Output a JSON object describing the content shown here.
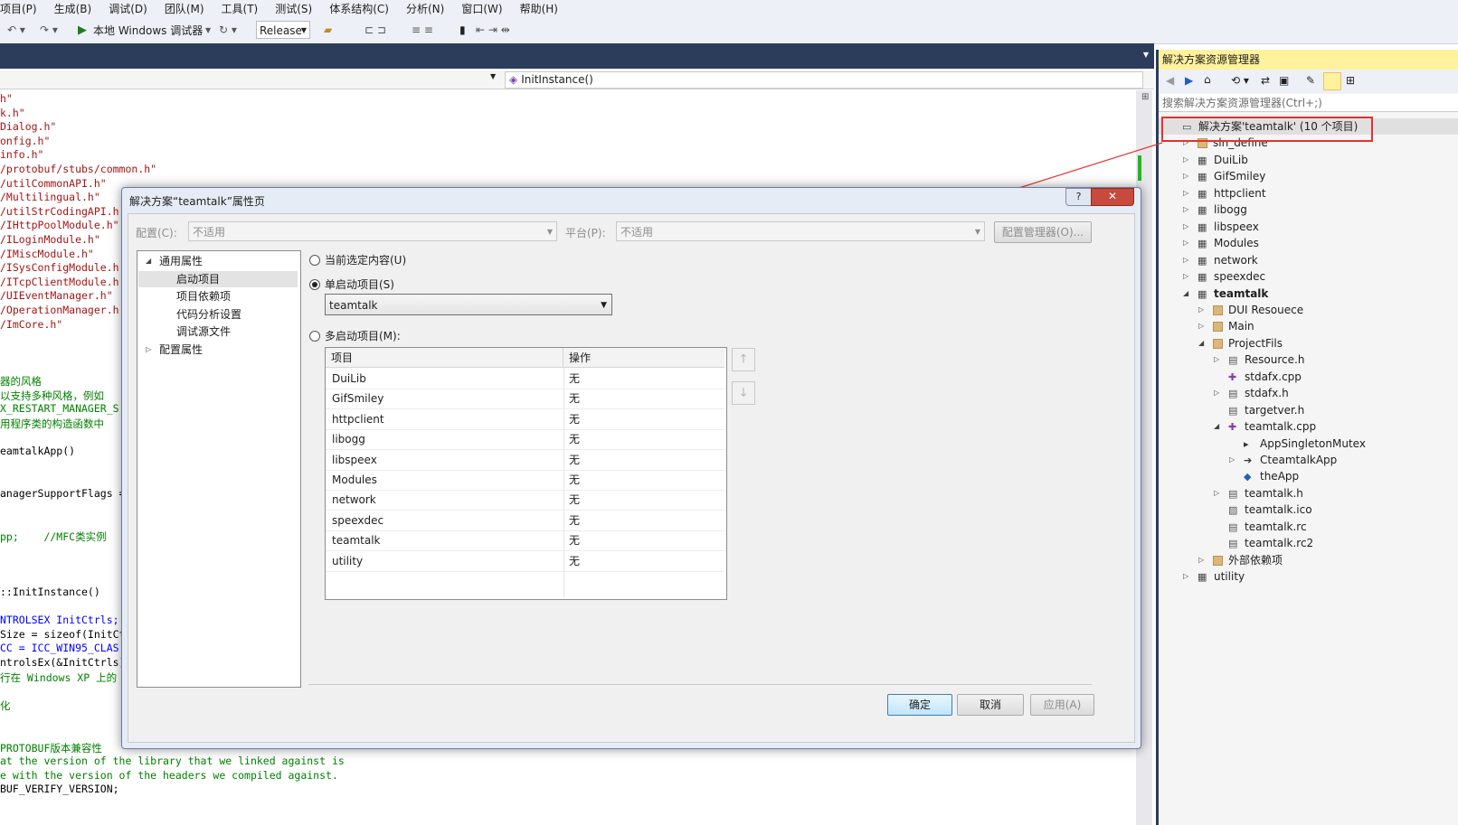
{
  "menu": [
    "项目(P)",
    "生成(B)",
    "调试(D)",
    "团队(M)",
    "工具(T)",
    "测试(S)",
    "体系结构(C)",
    "分析(N)",
    "窗口(W)",
    "帮助(H)"
  ],
  "toolbar": {
    "debugger_label": "本地 Windows 调试器",
    "config": "Release"
  },
  "editor": {
    "nav_right": "InitInstance()",
    "lines": [
      {
        "t": "h\"",
        "c": "red"
      },
      {
        "t": "k.h\"",
        "c": "red"
      },
      {
        "t": "Dialog.h\"",
        "c": "red"
      },
      {
        "t": "onfig.h\"",
        "c": "red"
      },
      {
        "t": "info.h\"",
        "c": "red"
      },
      {
        "t": "/protobuf/stubs/common.h\"",
        "c": "red"
      },
      {
        "t": "/utilCommonAPI.h\"",
        "c": "red"
      },
      {
        "t": "/Multilingual.h\"",
        "c": "red"
      },
      {
        "t": "/utilStrCodingAPI.h",
        "c": "red"
      },
      {
        "t": "/IHttpPoolModule.h\"",
        "c": "red"
      },
      {
        "t": "/ILoginModule.h\"",
        "c": "red"
      },
      {
        "t": "/IMiscModule.h\"",
        "c": "red"
      },
      {
        "t": "/ISysConfigModule.h",
        "c": "red"
      },
      {
        "t": "/ITcpClientModule.h",
        "c": "red"
      },
      {
        "t": "/UIEventManager.h\"",
        "c": "red"
      },
      {
        "t": "/OperationManager.h",
        "c": "red"
      },
      {
        "t": "/ImCore.h\"",
        "c": "red"
      },
      {
        "t": "",
        "c": "blk"
      },
      {
        "t": "",
        "c": "blk"
      },
      {
        "t": "",
        "c": "blk"
      },
      {
        "t": "器的风格",
        "c": "grn"
      },
      {
        "t": "以支持多种风格，例如",
        "c": "grn"
      },
      {
        "t": "X_RESTART_MANAGER_S",
        "c": "grn"
      },
      {
        "t": "用程序类的构造函数中",
        "c": "grn"
      },
      {
        "t": "",
        "c": "blk"
      },
      {
        "t": "eamtalkApp()",
        "c": "blk"
      },
      {
        "t": "",
        "c": "blk"
      },
      {
        "t": "",
        "c": "blk"
      },
      {
        "t": "anagerSupportFlags =",
        "c": "blk"
      },
      {
        "t": "",
        "c": "blk"
      },
      {
        "t": "",
        "c": "blk"
      },
      {
        "t": "pp;    //MFC类实例",
        "c": "grn"
      },
      {
        "t": "",
        "c": "blk"
      },
      {
        "t": "",
        "c": "blk"
      },
      {
        "t": "",
        "c": "blk"
      },
      {
        "t": "::InitInstance()",
        "c": "blk"
      },
      {
        "t": "",
        "c": "blk"
      },
      {
        "t": "NTROLSEX InitCtrls;",
        "c": "blu"
      },
      {
        "t": "Size = sizeof(InitCt",
        "c": "blk"
      },
      {
        "t": "CC = ICC_WIN95_CLAS",
        "c": "blu"
      },
      {
        "t": "ntrolsEx(&InitCtrls)",
        "c": "blk"
      },
      {
        "t": "行在 Windows XP 上的",
        "c": "grn"
      },
      {
        "t": "",
        "c": "blk"
      },
      {
        "t": "化",
        "c": "grn"
      },
      {
        "t": "",
        "c": "blk"
      },
      {
        "t": "",
        "c": "blk"
      },
      {
        "t": "PROTOBUF版本兼容性",
        "c": "grn"
      },
      {
        "t": "at the version of the library that we linked against is",
        "c": "grn"
      },
      {
        "t": "e with the version of the headers we compiled against.",
        "c": "grn"
      },
      {
        "t": "BUF_VERIFY_VERSION;",
        "c": "blk"
      }
    ]
  },
  "solution_explorer": {
    "title": "解决方案资源管理器",
    "search_placeholder": "搜索解决方案资源管理器(Ctrl+;)",
    "items": [
      {
        "label": "解决方案'teamtalk' (10 个项目)",
        "level": 0,
        "exp": "",
        "icon": "solution",
        "bold": false,
        "sel": true
      },
      {
        "label": "sln_define",
        "level": 1,
        "exp": "c",
        "icon": "folder",
        "bold": false
      },
      {
        "label": "DuiLib",
        "level": 1,
        "exp": "c",
        "icon": "project",
        "bold": false
      },
      {
        "label": "GifSmiley",
        "level": 1,
        "exp": "c",
        "icon": "project",
        "bold": false
      },
      {
        "label": "httpclient",
        "level": 1,
        "exp": "c",
        "icon": "project",
        "bold": false
      },
      {
        "label": "libogg",
        "level": 1,
        "exp": "c",
        "icon": "project",
        "bold": false
      },
      {
        "label": "libspeex",
        "level": 1,
        "exp": "c",
        "icon": "project",
        "bold": false
      },
      {
        "label": "Modules",
        "level": 1,
        "exp": "c",
        "icon": "project",
        "bold": false
      },
      {
        "label": "network",
        "level": 1,
        "exp": "c",
        "icon": "project",
        "bold": false
      },
      {
        "label": "speexdec",
        "level": 1,
        "exp": "c",
        "icon": "project",
        "bold": false
      },
      {
        "label": "teamtalk",
        "level": 1,
        "exp": "e",
        "icon": "project",
        "bold": true
      },
      {
        "label": "DUI Resouece",
        "level": 2,
        "exp": "c",
        "icon": "folder",
        "bold": false
      },
      {
        "label": "Main",
        "level": 2,
        "exp": "c",
        "icon": "folder",
        "bold": false
      },
      {
        "label": "ProjectFils",
        "level": 2,
        "exp": "e",
        "icon": "folder",
        "bold": false
      },
      {
        "label": "Resource.h",
        "level": 3,
        "exp": "c",
        "icon": "file",
        "bold": false
      },
      {
        "label": "stdafx.cpp",
        "level": 3,
        "exp": "",
        "icon": "cpp",
        "bold": false
      },
      {
        "label": "stdafx.h",
        "level": 3,
        "exp": "c",
        "icon": "file",
        "bold": false
      },
      {
        "label": "targetver.h",
        "level": 3,
        "exp": "",
        "icon": "file",
        "bold": false
      },
      {
        "label": "teamtalk.cpp",
        "level": 3,
        "exp": "e",
        "icon": "cpp",
        "bold": false
      },
      {
        "label": "AppSingletonMutex",
        "level": 4,
        "exp": "",
        "icon": "member",
        "bold": false
      },
      {
        "label": "CteamtalkApp",
        "level": 4,
        "exp": "c",
        "icon": "class",
        "bold": false
      },
      {
        "label": "theApp",
        "level": 4,
        "exp": "",
        "icon": "var",
        "bold": false
      },
      {
        "label": "teamtalk.h",
        "level": 3,
        "exp": "c",
        "icon": "file",
        "bold": false
      },
      {
        "label": "teamtalk.ico",
        "level": 3,
        "exp": "",
        "icon": "image",
        "bold": false
      },
      {
        "label": "teamtalk.rc",
        "level": 3,
        "exp": "",
        "icon": "file",
        "bold": false
      },
      {
        "label": "teamtalk.rc2",
        "level": 3,
        "exp": "",
        "icon": "file",
        "bold": false
      },
      {
        "label": "外部依赖项",
        "level": 2,
        "exp": "c",
        "icon": "folder",
        "bold": false
      },
      {
        "label": "utility",
        "level": 1,
        "exp": "c",
        "icon": "project",
        "bold": false
      }
    ]
  },
  "dialog": {
    "title": "解决方案“teamtalk”属性页",
    "help": "?",
    "close": "✕",
    "config_label": "配置(C):",
    "config_value": "不适用",
    "platform_label": "平台(P):",
    "platform_value": "不适用",
    "config_manager": "配置管理器(O)...",
    "tree": [
      {
        "label": "通用属性",
        "level": 0,
        "exp": "e"
      },
      {
        "label": "启动项目",
        "level": 1,
        "exp": "",
        "sel": true
      },
      {
        "label": "项目依赖项",
        "level": 1,
        "exp": ""
      },
      {
        "label": "代码分析设置",
        "level": 1,
        "exp": ""
      },
      {
        "label": "调试源文件",
        "level": 1,
        "exp": ""
      },
      {
        "label": "配置属性",
        "level": 0,
        "exp": "c"
      }
    ],
    "radio_current": "当前选定内容(U)",
    "radio_single": "单启动项目(S)",
    "single_value": "teamtalk",
    "radio_multi": "多启动项目(M):",
    "grid_headers": [
      "项目",
      "操作"
    ],
    "grid_rows": [
      [
        "DuiLib",
        "无"
      ],
      [
        "GifSmiley",
        "无"
      ],
      [
        "httpclient",
        "无"
      ],
      [
        "libogg",
        "无"
      ],
      [
        "libspeex",
        "无"
      ],
      [
        "Modules",
        "无"
      ],
      [
        "network",
        "无"
      ],
      [
        "speexdec",
        "无"
      ],
      [
        "teamtalk",
        "无"
      ],
      [
        "utility",
        "无"
      ]
    ],
    "ok": "确定",
    "cancel": "取消",
    "apply": "应用(A)"
  },
  "colors": {
    "annotation": "#e83030",
    "title_bar": "#2b3d5b",
    "se_header": "#fff29d"
  }
}
